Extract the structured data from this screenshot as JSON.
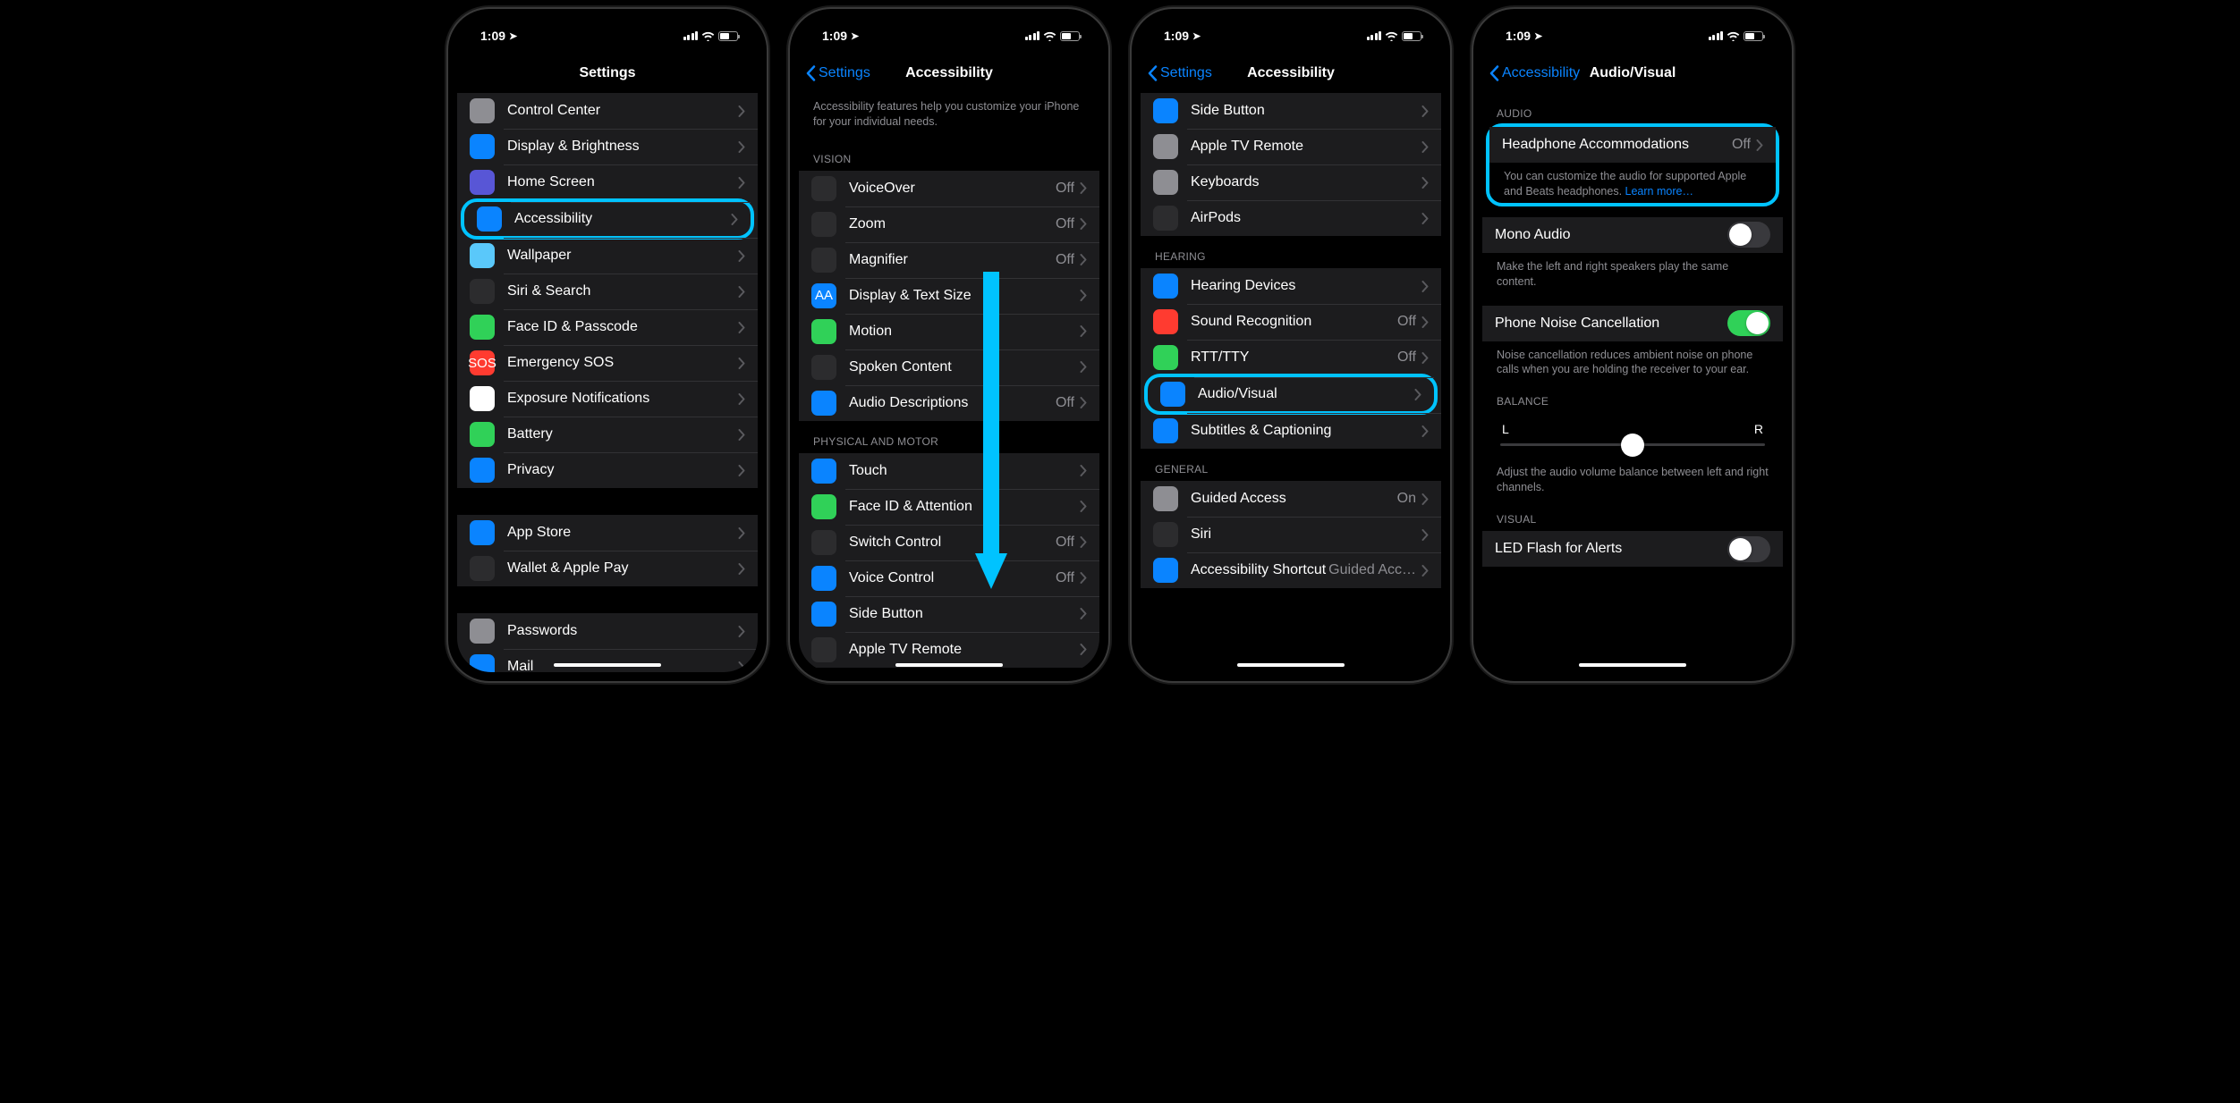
{
  "status": {
    "time": "1:09"
  },
  "phone1": {
    "title": "Settings",
    "rows": [
      {
        "label": "Control Center",
        "iconColor": "bg-grey"
      },
      {
        "label": "Display & Brightness",
        "iconColor": "bg-blue"
      },
      {
        "label": "Home Screen",
        "iconColor": "bg-purple"
      },
      {
        "label": "Accessibility",
        "iconColor": "bg-blue",
        "highlight": true
      },
      {
        "label": "Wallpaper",
        "iconColor": "bg-cyan"
      },
      {
        "label": "Siri & Search",
        "iconColor": "bg-dark"
      },
      {
        "label": "Face ID & Passcode",
        "iconColor": "bg-green"
      },
      {
        "label": "Emergency SOS",
        "iconColor": "bg-red",
        "iconText": "SOS"
      },
      {
        "label": "Exposure Notifications",
        "iconColor": "bg-white"
      },
      {
        "label": "Battery",
        "iconColor": "bg-green"
      },
      {
        "label": "Privacy",
        "iconColor": "bg-blue"
      }
    ],
    "rows2": [
      {
        "label": "App Store",
        "iconColor": "bg-blue"
      },
      {
        "label": "Wallet & Apple Pay",
        "iconColor": "bg-dark"
      }
    ],
    "rows3": [
      {
        "label": "Passwords",
        "iconColor": "bg-grey"
      },
      {
        "label": "Mail",
        "iconColor": "bg-blue"
      }
    ]
  },
  "phone2": {
    "back": "Settings",
    "title": "Accessibility",
    "desc": "Accessibility features help you customize your iPhone for your individual needs.",
    "vision_header": "VISION",
    "vision": [
      {
        "label": "VoiceOver",
        "value": "Off",
        "iconColor": "bg-dark"
      },
      {
        "label": "Zoom",
        "value": "Off",
        "iconColor": "bg-dark"
      },
      {
        "label": "Magnifier",
        "value": "Off",
        "iconColor": "bg-dark"
      },
      {
        "label": "Display & Text Size",
        "iconColor": "bg-blue",
        "iconText": "AA"
      },
      {
        "label": "Motion",
        "iconColor": "bg-green"
      },
      {
        "label": "Spoken Content",
        "iconColor": "bg-dark"
      },
      {
        "label": "Audio Descriptions",
        "value": "Off",
        "iconColor": "bg-blue"
      }
    ],
    "motor_header": "PHYSICAL AND MOTOR",
    "motor": [
      {
        "label": "Touch",
        "iconColor": "bg-blue"
      },
      {
        "label": "Face ID & Attention",
        "iconColor": "bg-green"
      },
      {
        "label": "Switch Control",
        "value": "Off",
        "iconColor": "bg-dark"
      },
      {
        "label": "Voice Control",
        "value": "Off",
        "iconColor": "bg-blue"
      },
      {
        "label": "Side Button",
        "iconColor": "bg-blue"
      },
      {
        "label": "Apple TV Remote",
        "iconColor": "bg-dark"
      }
    ]
  },
  "phone3": {
    "back": "Settings",
    "title": "Accessibility",
    "top": [
      {
        "label": "Side Button",
        "iconColor": "bg-blue"
      },
      {
        "label": "Apple TV Remote",
        "iconColor": "bg-grey"
      },
      {
        "label": "Keyboards",
        "iconColor": "bg-grey"
      },
      {
        "label": "AirPods",
        "iconColor": "bg-dark"
      }
    ],
    "hearing_header": "HEARING",
    "hearing": [
      {
        "label": "Hearing Devices",
        "iconColor": "bg-blue"
      },
      {
        "label": "Sound Recognition",
        "value": "Off",
        "iconColor": "bg-red"
      },
      {
        "label": "RTT/TTY",
        "value": "Off",
        "iconColor": "bg-green"
      },
      {
        "label": "Audio/Visual",
        "iconColor": "bg-blue",
        "highlight": true
      },
      {
        "label": "Subtitles & Captioning",
        "iconColor": "bg-blue"
      }
    ],
    "general_header": "GENERAL",
    "general": [
      {
        "label": "Guided Access",
        "value": "On",
        "iconColor": "bg-grey"
      },
      {
        "label": "Siri",
        "iconColor": "bg-dark"
      },
      {
        "label": "Accessibility Shortcut",
        "value": "Guided Acc…",
        "iconColor": "bg-blue"
      }
    ]
  },
  "phone4": {
    "back": "Accessibility",
    "title": "Audio/Visual",
    "audio_header": "AUDIO",
    "headphone": {
      "label": "Headphone Accommodations",
      "value": "Off"
    },
    "headphone_footer": "You can customize the audio for supported Apple and Beats headphones. ",
    "learn_more": "Learn more…",
    "mono": {
      "label": "Mono Audio"
    },
    "mono_footer": "Make the left and right speakers play the same content.",
    "noise": {
      "label": "Phone Noise Cancellation"
    },
    "noise_footer": "Noise cancellation reduces ambient noise on phone calls when you are holding the receiver to your ear.",
    "balance_header": "BALANCE",
    "balance_left": "L",
    "balance_right": "R",
    "balance_footer": "Adjust the audio volume balance between left and right channels.",
    "visual_header": "VISUAL",
    "led": {
      "label": "LED Flash for Alerts"
    }
  }
}
